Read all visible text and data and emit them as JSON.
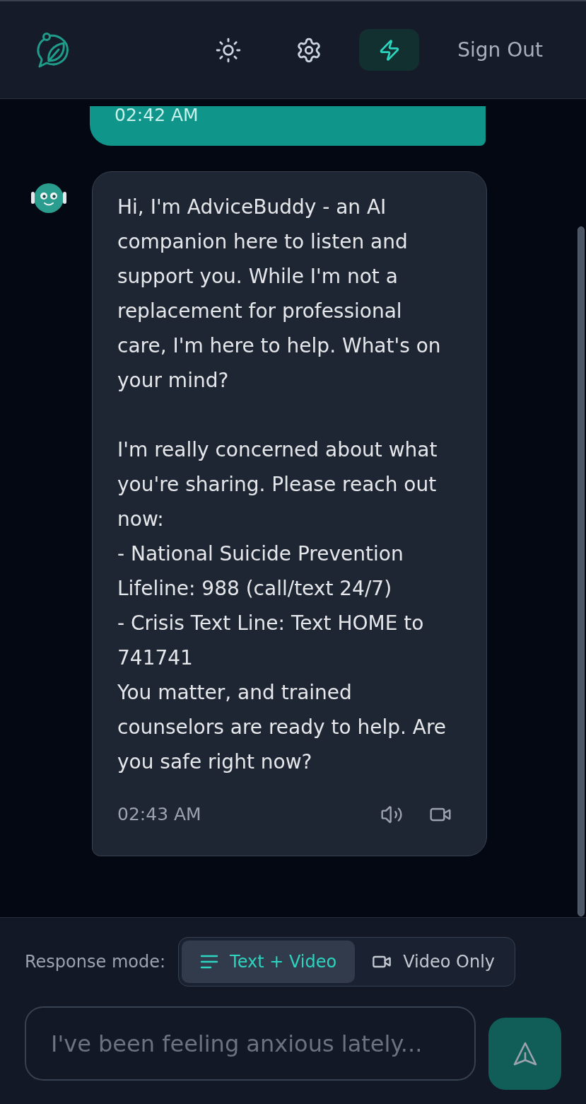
{
  "header": {
    "tool_buttons": [
      {
        "kind": "theme",
        "selected": false
      },
      {
        "kind": "settings",
        "selected": false
      },
      {
        "kind": "bolt",
        "selected": true
      }
    ],
    "sign_out": "Sign Out"
  },
  "messages": [
    {
      "kind": "user",
      "time": "02:42 AM"
    },
    {
      "kind": "assistant",
      "text": "Hi, I'm AdviceBuddy - an AI companion here to listen and support you. While I'm not a replacement for professional care, I'm here to help. What's on your mind?\n\nI'm really concerned about what you're sharing. Please reach out now:\n- National Suicide Prevention Lifeline: 988 (call/text 24/7)\n- Crisis Text Line: Text HOME to 741741\nYou matter, and trained counselors are ready to help. Are you safe right now?",
      "time": "02:43 AM"
    }
  ],
  "response_mode": {
    "label": "Response mode:",
    "options": [
      {
        "kind": "text",
        "label": "Text + Video",
        "selected": true
      },
      {
        "kind": "video",
        "label": "Video Only",
        "selected": false
      }
    ]
  },
  "composer": {
    "placeholder": "I've been feeling anxious lately..."
  }
}
